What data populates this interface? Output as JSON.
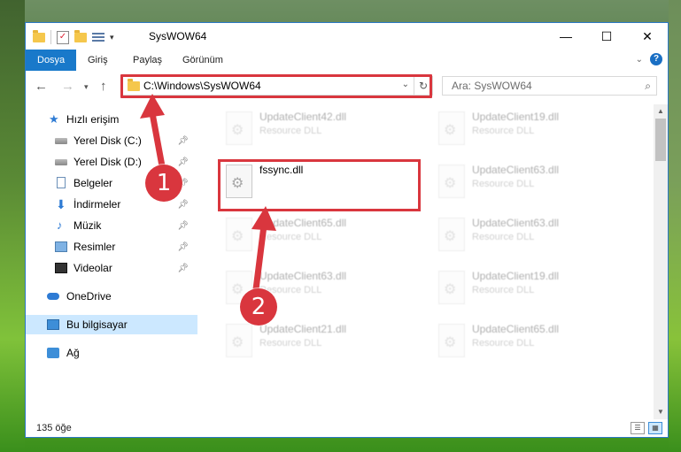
{
  "window": {
    "title": "SysWOW64",
    "controls": {
      "minimize": "—",
      "maximize": "☐",
      "close": "✕"
    }
  },
  "ribbon": {
    "tabs": [
      "Dosya",
      "Giriş",
      "Paylaş",
      "Görünüm"
    ]
  },
  "address": {
    "path": "C:\\Windows\\SysWOW64",
    "search_placeholder": "Ara: SysWOW64"
  },
  "nav": {
    "quick_access": "Hızlı erişim",
    "items": [
      {
        "label": "Yerel Disk (C:)",
        "icon": "drive-icon"
      },
      {
        "label": "Yerel Disk (D:)",
        "icon": "drive-icon"
      },
      {
        "label": "Belgeler",
        "icon": "documents-icon"
      },
      {
        "label": "İndirmeler",
        "icon": "downloads-icon"
      },
      {
        "label": "Müzik",
        "icon": "music-icon"
      },
      {
        "label": "Resimler",
        "icon": "pictures-icon"
      },
      {
        "label": "Videolar",
        "icon": "videos-icon"
      }
    ],
    "onedrive": "OneDrive",
    "this_pc": "Bu bilgisayar",
    "network": "Ağ"
  },
  "files": [
    {
      "name": "UpdateClient42.dll",
      "desc": "Resource DLL"
    },
    {
      "name": "UpdateClient19.dll",
      "desc": "Resource DLL"
    },
    {
      "name": "fssync.dll",
      "desc": ""
    },
    {
      "name": "UpdateClient63.dll",
      "desc": "Resource DLL"
    },
    {
      "name": "UpdateClient65.dll",
      "desc": "Resource DLL"
    },
    {
      "name": "UpdateClient63.dll",
      "desc": "Resource DLL"
    },
    {
      "name": "UpdateClient63.dll",
      "desc": "Resource DLL"
    },
    {
      "name": "UpdateClient19.dll",
      "desc": "Resource DLL"
    },
    {
      "name": "UpdateClient21.dll",
      "desc": "Resource DLL"
    },
    {
      "name": "UpdateClient65.dll",
      "desc": "Resource DLL"
    }
  ],
  "status": {
    "item_count": "135 öğe"
  },
  "callouts": {
    "one": "1",
    "two": "2"
  },
  "colors": {
    "accent": "#1979ca",
    "highlight": "#d9363e",
    "selection": "#cce8ff"
  }
}
